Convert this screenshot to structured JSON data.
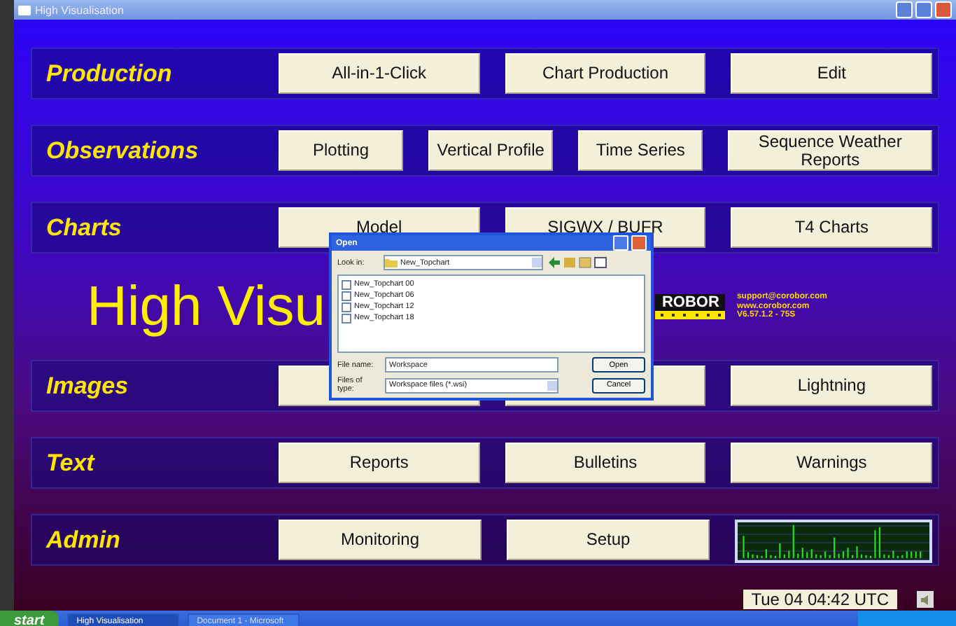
{
  "window": {
    "title": "High Visualisation"
  },
  "rows": [
    {
      "label": "Production",
      "buttons": [
        {
          "label": "All-in-1-Click"
        },
        {
          "label": "Chart Production"
        },
        {
          "label": "Edit"
        }
      ]
    },
    {
      "label": "Observations",
      "buttons": [
        {
          "label": "Plotting"
        },
        {
          "label": "Vertical Profile"
        },
        {
          "label": "Time Series"
        },
        {
          "label": "Sequence Weather Reports"
        }
      ]
    },
    {
      "label": "Charts",
      "buttons": [
        {
          "label": "Model"
        },
        {
          "label": "SIGWX / BUFR"
        },
        {
          "label": "T4 Charts"
        }
      ]
    },
    {
      "kind": "hero",
      "title": "High Visu",
      "logo": "ROBOR",
      "support": [
        "support@corobor.com",
        "www.corobor.com",
        "V6.57.1.2 - 75S"
      ]
    },
    {
      "label": "Images",
      "buttons": [
        {
          "kind": "covered"
        },
        {
          "kind": "covered"
        },
        {
          "label": "Lightning"
        }
      ]
    },
    {
      "label": "Text",
      "buttons": [
        {
          "label": "Reports"
        },
        {
          "label": "Bulletins"
        },
        {
          "label": "Warnings"
        }
      ]
    },
    {
      "label": "Admin",
      "buttons": [
        {
          "label": "Monitoring"
        },
        {
          "label": "Setup"
        },
        {
          "kind": "monitor"
        }
      ]
    }
  ],
  "clock": "Tue 04 04:42 UTC",
  "dialog": {
    "title": "Open",
    "look_in_label": "Look in:",
    "look_in": "New_Topchart",
    "files": [
      "New_Topchart 00",
      "New_Topchart 06",
      "New_Topchart 12",
      "New_Topchart 18"
    ],
    "file_name_label": "File name:",
    "file_name": "Workspace",
    "file_type_label": "Files of type:",
    "file_type": "Workspace files (*.wsi)",
    "buttons": [
      "Open",
      "Cancel"
    ]
  },
  "taskbar": {
    "start": "start",
    "items": [
      {
        "label": "High Visualisation",
        "selected": true
      },
      {
        "label": "Document 1 - Microsoft",
        "selected": false
      }
    ]
  }
}
